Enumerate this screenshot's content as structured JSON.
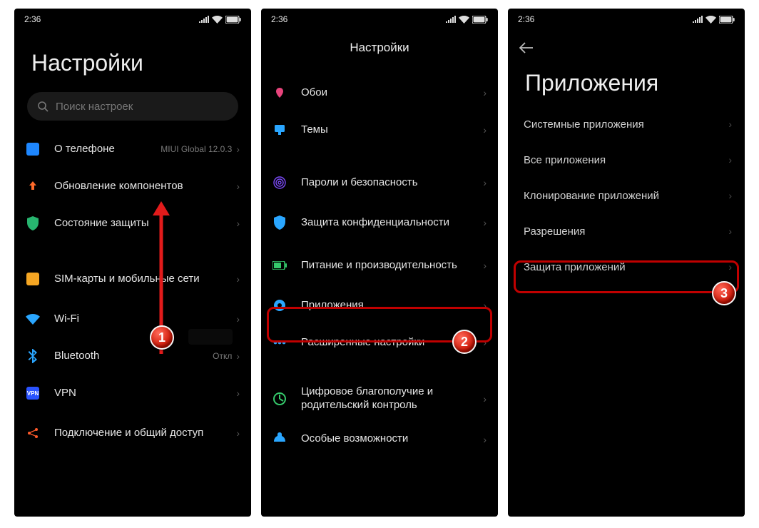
{
  "status": {
    "time": "2:36"
  },
  "screen1": {
    "title": "Настройки",
    "search_placeholder": "Поиск настроек",
    "rows": {
      "about": {
        "label": "О телефоне",
        "value": "MIUI Global 12.0.3"
      },
      "updates": {
        "label": "Обновление компонентов"
      },
      "security_state": {
        "label": "Состояние защиты"
      },
      "sim": {
        "label": "SIM-карты и мобильные сети"
      },
      "wifi": {
        "label": "Wi-Fi"
      },
      "bluetooth": {
        "label": "Bluetooth",
        "value": "Откл"
      },
      "vpn": {
        "label": "VPN"
      },
      "share": {
        "label": "Подключение и общий доступ"
      }
    },
    "badge": "1"
  },
  "screen2": {
    "title": "Настройки",
    "rows": {
      "wallpaper": {
        "label": "Обои"
      },
      "themes": {
        "label": "Темы"
      },
      "passwords": {
        "label": "Пароли и безопасность"
      },
      "privacy": {
        "label": "Защита конфиденциальности"
      },
      "battery": {
        "label": "Питание и производительность"
      },
      "apps": {
        "label": "Приложения"
      },
      "advanced": {
        "label": "Расширенные настройки"
      },
      "wellbeing": {
        "label": "Цифровое благополучие и родительский контроль"
      },
      "accessibility": {
        "label": "Особые возможности"
      }
    },
    "badge": "2"
  },
  "screen3": {
    "title": "Приложения",
    "rows": {
      "system_apps": {
        "label": "Системные приложения"
      },
      "all_apps": {
        "label": "Все приложения"
      },
      "dual_apps": {
        "label": "Клонирование приложений"
      },
      "permissions": {
        "label": "Разрешения"
      },
      "app_lock": {
        "label": "Защита приложений"
      }
    },
    "badge": "3"
  }
}
